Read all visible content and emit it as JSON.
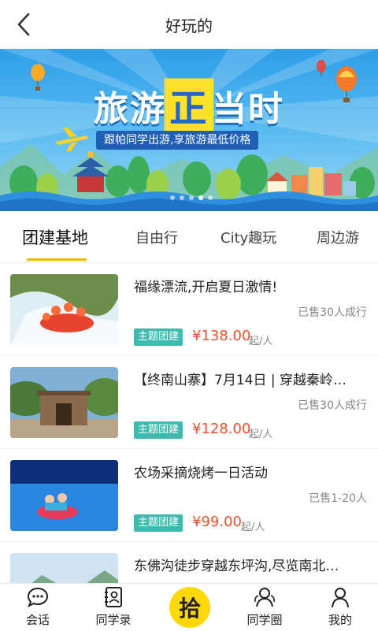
{
  "header": {
    "title": "好玩的",
    "back_icon": "chevron-left-icon"
  },
  "banner": {
    "title_part1": "旅游",
    "title_highlight": "正",
    "title_part2": "当时",
    "subtitle": "跟帕同学出游,享旅游最低价格",
    "dots_total": 5,
    "dots_active_index": 3
  },
  "tabs": [
    "团建基地",
    "自由行",
    "City趣玩",
    "周边游"
  ],
  "tabs_active_index": 0,
  "items": [
    {
      "title": "福缘漂流,开启夏日激情!",
      "sold": "已售30人成行",
      "tag": "主题团建",
      "price": "¥138.00",
      "unit": "起/人"
    },
    {
      "title": "【终南山寨】7月14日 | 穿越秦岭…",
      "sold": "已售30人成行",
      "tag": "主题团建",
      "price": "¥128.00",
      "unit": "起/人"
    },
    {
      "title": "农场采摘烧烤一日活动",
      "sold": "已售1-20人",
      "tag": "主题团建",
      "price": "¥99.00",
      "unit": "起/人"
    },
    {
      "title": "东佛沟徒步穿越东坪沟,尽览南北…",
      "sold": "",
      "tag": "",
      "price": "",
      "unit": ""
    }
  ],
  "tabbar": {
    "items": [
      {
        "label": "会话",
        "icon": "chat-bubble-icon"
      },
      {
        "label": "同学录",
        "icon": "contacts-book-icon"
      },
      {
        "label": "同学圈",
        "icon": "friends-circle-icon"
      },
      {
        "label": "我的",
        "icon": "person-icon"
      }
    ],
    "center_label": "拾"
  },
  "colors": {
    "accent": "#f5b800",
    "tag": "#3dbbae",
    "price": "#f0502a",
    "center_button": "#ffd80c"
  }
}
